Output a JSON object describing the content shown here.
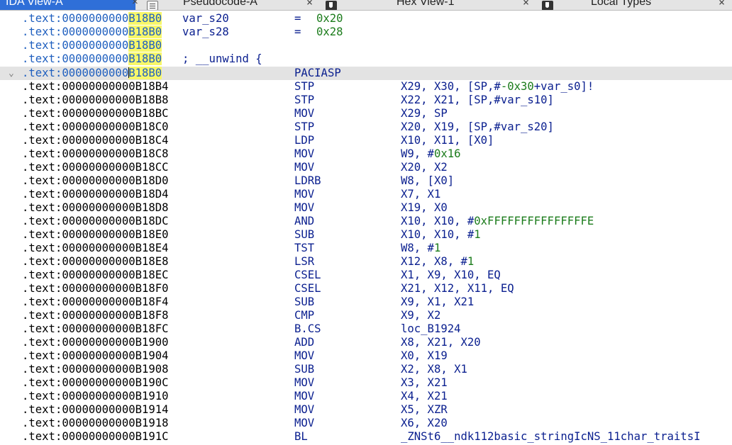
{
  "tabs": [
    {
      "label": "IDA View-A",
      "close": "×",
      "icon": "doc-icon"
    },
    {
      "label": "Pseudocode-A",
      "close": "×",
      "icon": "shield-icon"
    },
    {
      "label": "Hex View-1",
      "close": "×",
      "icon": "shield-icon"
    },
    {
      "label": "Local Types",
      "close": "×"
    }
  ],
  "header_rows": [
    {
      "addr_prefix": ".text:0000000000",
      "addr_hl": "B18B0",
      "text": "var_s20",
      "eq": "=",
      "val": "0x20"
    },
    {
      "addr_prefix": ".text:0000000000",
      "addr_hl": "B18B0",
      "text": "var_s28",
      "eq": "=",
      "val": "0x28"
    },
    {
      "addr_prefix": ".text:0000000000",
      "addr_hl": "B18B0",
      "text": "",
      "eq": "",
      "val": ""
    },
    {
      "addr_prefix": ".text:0000000000",
      "addr_hl": "B18B0",
      "text": "; __unwind {",
      "eq": "",
      "val": ""
    }
  ],
  "current_row": {
    "addr_prefix": ".text:0000000000",
    "addr_hl": "B18B0",
    "mnemonic": "PACIASP",
    "chevron": "⌄"
  },
  "rows": [
    {
      "addr": ".text:00000000000B18B4",
      "mn": "STP",
      "ops": [
        [
          "X29, X30, [SP,#",
          "t"
        ],
        [
          "-0x30",
          "n"
        ],
        [
          "+var_s0]!",
          "t"
        ]
      ]
    },
    {
      "addr": ".text:00000000000B18B8",
      "mn": "STP",
      "ops": [
        [
          "X22, X21, [SP,#var_s10]",
          "t"
        ]
      ]
    },
    {
      "addr": ".text:00000000000B18BC",
      "mn": "MOV",
      "ops": [
        [
          "X29, SP",
          "t"
        ]
      ]
    },
    {
      "addr": ".text:00000000000B18C0",
      "mn": "STP",
      "ops": [
        [
          "X20, X19, [SP,#var_s20]",
          "t"
        ]
      ]
    },
    {
      "addr": ".text:00000000000B18C4",
      "mn": "LDP",
      "ops": [
        [
          "X10, X11, [X0]",
          "t"
        ]
      ]
    },
    {
      "addr": ".text:00000000000B18C8",
      "mn": "MOV",
      "ops": [
        [
          "W9, #",
          "t"
        ],
        [
          "0x16",
          "n"
        ]
      ]
    },
    {
      "addr": ".text:00000000000B18CC",
      "mn": "MOV",
      "ops": [
        [
          "X20, X2",
          "t"
        ]
      ]
    },
    {
      "addr": ".text:00000000000B18D0",
      "mn": "LDRB",
      "ops": [
        [
          "W8, [X0]",
          "t"
        ]
      ]
    },
    {
      "addr": ".text:00000000000B18D4",
      "mn": "MOV",
      "ops": [
        [
          "X7, X1",
          "t"
        ]
      ]
    },
    {
      "addr": ".text:00000000000B18D8",
      "mn": "MOV",
      "ops": [
        [
          "X19, X0",
          "t"
        ]
      ]
    },
    {
      "addr": ".text:00000000000B18DC",
      "mn": "AND",
      "ops": [
        [
          "X10, X10, #",
          "t"
        ],
        [
          "0xFFFFFFFFFFFFFFFE",
          "n"
        ]
      ]
    },
    {
      "addr": ".text:00000000000B18E0",
      "mn": "SUB",
      "ops": [
        [
          "X10, X10, #",
          "t"
        ],
        [
          "1",
          "n"
        ]
      ]
    },
    {
      "addr": ".text:00000000000B18E4",
      "mn": "TST",
      "ops": [
        [
          "W8, #",
          "t"
        ],
        [
          "1",
          "n"
        ]
      ]
    },
    {
      "addr": ".text:00000000000B18E8",
      "mn": "LSR",
      "ops": [
        [
          "X12, X8, #",
          "t"
        ],
        [
          "1",
          "n"
        ]
      ]
    },
    {
      "addr": ".text:00000000000B18EC",
      "mn": "CSEL",
      "ops": [
        [
          "X1, X9, X10, EQ",
          "t"
        ]
      ]
    },
    {
      "addr": ".text:00000000000B18F0",
      "mn": "CSEL",
      "ops": [
        [
          "X21, X12, X11, EQ",
          "t"
        ]
      ]
    },
    {
      "addr": ".text:00000000000B18F4",
      "mn": "SUB",
      "ops": [
        [
          "X9, X1, X21",
          "t"
        ]
      ]
    },
    {
      "addr": ".text:00000000000B18F8",
      "mn": "CMP",
      "ops": [
        [
          "X9, X2",
          "t"
        ]
      ]
    },
    {
      "addr": ".text:00000000000B18FC",
      "mn": "B.CS",
      "ops": [
        [
          "loc_B1924",
          "t"
        ]
      ]
    },
    {
      "addr": ".text:00000000000B1900",
      "mn": "ADD",
      "ops": [
        [
          "X8, X21, X20",
          "t"
        ]
      ]
    },
    {
      "addr": ".text:00000000000B1904",
      "mn": "MOV",
      "ops": [
        [
          "X0, X19",
          "t"
        ]
      ]
    },
    {
      "addr": ".text:00000000000B1908",
      "mn": "SUB",
      "ops": [
        [
          "X2, X8, X1",
          "t"
        ]
      ]
    },
    {
      "addr": ".text:00000000000B190C",
      "mn": "MOV",
      "ops": [
        [
          "X3, X21",
          "t"
        ]
      ]
    },
    {
      "addr": ".text:00000000000B1910",
      "mn": "MOV",
      "ops": [
        [
          "X4, X21",
          "t"
        ]
      ]
    },
    {
      "addr": ".text:00000000000B1914",
      "mn": "MOV",
      "ops": [
        [
          "X5, XZR",
          "t"
        ]
      ]
    },
    {
      "addr": ".text:00000000000B1918",
      "mn": "MOV",
      "ops": [
        [
          "X6, X20",
          "t"
        ]
      ]
    },
    {
      "addr": ".text:00000000000B191C",
      "mn": "BL",
      "ops": [
        [
          "_ZNSt6__ndk112basic_stringIcNS_11char_traitsI",
          "t"
        ]
      ]
    }
  ]
}
